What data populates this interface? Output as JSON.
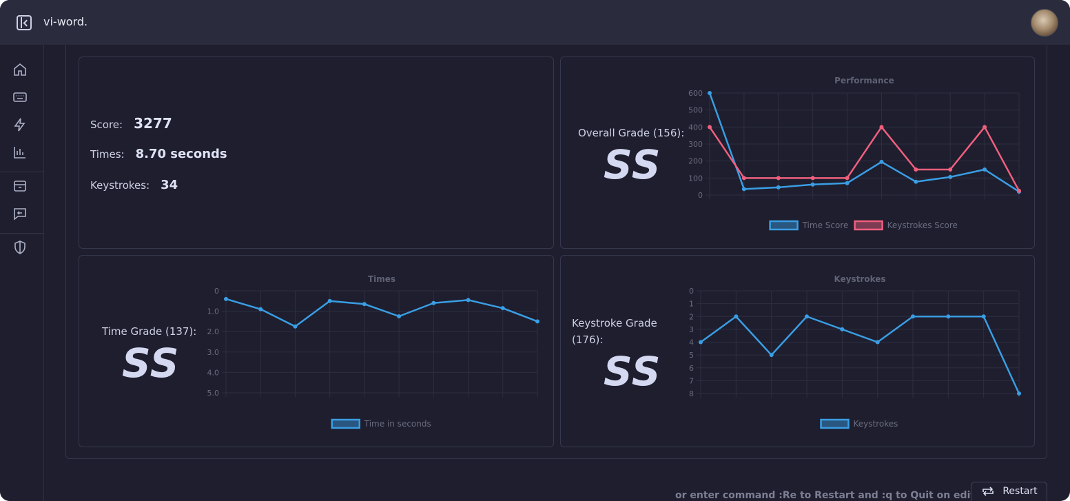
{
  "app": {
    "title": "vi-word."
  },
  "stats": {
    "score_label": "Score:",
    "score_value": "3277",
    "times_label": "Times:",
    "times_value": "8.70 seconds",
    "keystrokes_label": "Keystrokes:",
    "keystrokes_value": "34"
  },
  "grades": {
    "overall_label": "Overall Grade (156):",
    "overall_letter": "SS",
    "time_label": "Time Grade (137):",
    "time_letter": "SS",
    "keystroke_label_line1": "Keystroke Grade",
    "keystroke_label_line2": "(176):",
    "keystroke_letter": "SS"
  },
  "footer": {
    "hint": "or enter command :Re to Restart and :q to Quit on editor.",
    "restart_label": "Restart"
  },
  "colors": {
    "blue": "#3a9ee4",
    "red": "#f0607e",
    "grid": "#2d2f41",
    "tick": "#6a6d80"
  },
  "chart_data": [
    {
      "type": "line",
      "title": "Performance",
      "x": [
        1,
        2,
        3,
        4,
        5,
        6,
        7,
        8,
        9,
        10
      ],
      "ylim": [
        0,
        600
      ],
      "yticks": [
        "0",
        "100",
        "200",
        "300",
        "400",
        "500",
        "600"
      ],
      "series": [
        {
          "name": "Time Score",
          "color": "#3a9ee4",
          "values": [
            600,
            35,
            45,
            62,
            70,
            195,
            78,
            106,
            150,
            20
          ]
        },
        {
          "name": "Keystrokes Score",
          "color": "#f0607e",
          "values": [
            400,
            100,
            100,
            100,
            100,
            400,
            150,
            150,
            400,
            25
          ]
        }
      ],
      "legend": "bottom"
    },
    {
      "type": "line",
      "title": "Times",
      "x": [
        1,
        2,
        3,
        4,
        5,
        6,
        7,
        8,
        9,
        10
      ],
      "ylim": [
        0,
        5
      ],
      "reversed": true,
      "yticks": [
        "0",
        "1.0",
        "2.0",
        "3.0",
        "4.0",
        "5.0"
      ],
      "series": [
        {
          "name": "Time in seconds",
          "color": "#3a9ee4",
          "values": [
            0.4,
            0.9,
            1.75,
            0.5,
            0.65,
            1.25,
            0.6,
            0.45,
            0.85,
            1.5
          ]
        }
      ],
      "legend": "bottom"
    },
    {
      "type": "line",
      "title": "Keystrokes",
      "x": [
        1,
        2,
        3,
        4,
        5,
        6,
        7,
        8,
        9,
        10
      ],
      "ylim": [
        0,
        8
      ],
      "reversed": true,
      "yticks": [
        "0",
        "1",
        "2",
        "3",
        "4",
        "5",
        "6",
        "7",
        "8"
      ],
      "series": [
        {
          "name": "Keystrokes",
          "color": "#3a9ee4",
          "values": [
            4,
            2,
            5,
            2,
            3,
            4,
            2,
            2,
            2,
            8
          ]
        }
      ],
      "legend": "bottom"
    }
  ]
}
